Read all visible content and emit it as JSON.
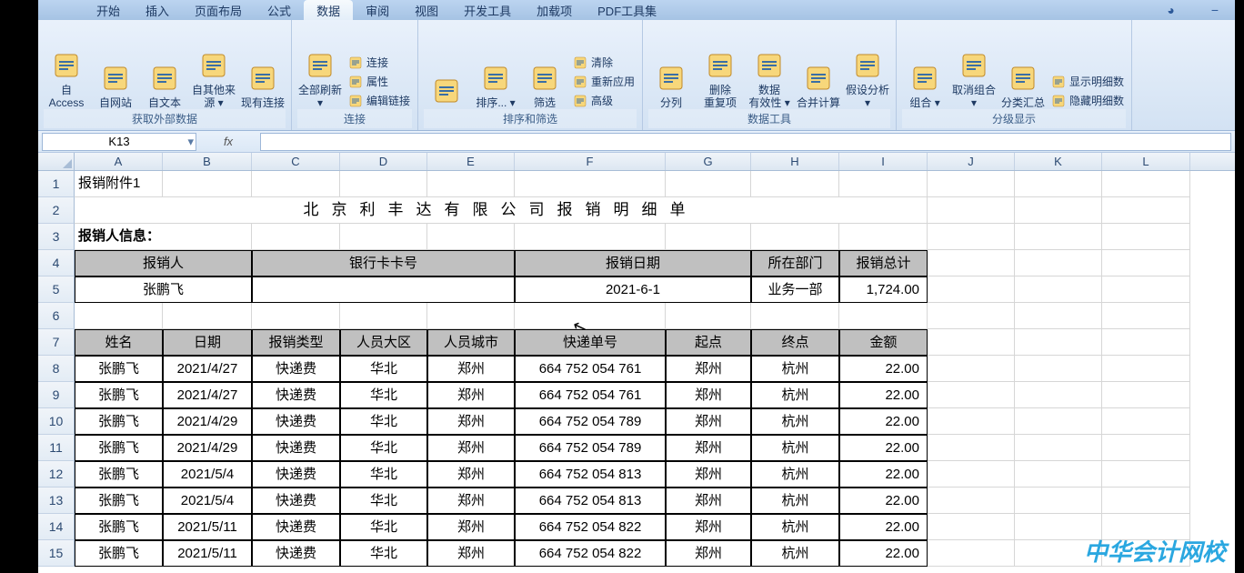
{
  "tabs": {
    "items": [
      "开始",
      "插入",
      "页面布局",
      "公式",
      "数据",
      "审阅",
      "视图",
      "开发工具",
      "加载项",
      "PDF工具集"
    ],
    "activeIndex": 4
  },
  "ribbon": {
    "groups": [
      {
        "label": "获取外部数据",
        "big": [
          {
            "name": "from-access",
            "label": "自 Access"
          },
          {
            "name": "from-web",
            "label": "自网站"
          },
          {
            "name": "from-text",
            "label": "自文本"
          },
          {
            "name": "from-other",
            "label": "自其他来源",
            "dd": true
          },
          {
            "name": "existing-conn",
            "label": "现有连接"
          }
        ]
      },
      {
        "label": "连接",
        "big": [
          {
            "name": "refresh-all",
            "label": "全部刷新",
            "dd": true
          }
        ],
        "small": [
          {
            "name": "connections",
            "label": "连接"
          },
          {
            "name": "properties",
            "label": "属性"
          },
          {
            "name": "edit-links",
            "label": "编辑链接"
          }
        ]
      },
      {
        "label": "排序和筛选",
        "big": [
          {
            "name": "sort-az",
            "label": ""
          },
          {
            "name": "sort",
            "label": "排序...",
            "dd": true
          },
          {
            "name": "filter",
            "label": "筛选"
          }
        ],
        "small": [
          {
            "name": "clear",
            "label": "清除"
          },
          {
            "name": "reapply",
            "label": "重新应用"
          },
          {
            "name": "advanced",
            "label": "高级"
          }
        ]
      },
      {
        "label": "数据工具",
        "big": [
          {
            "name": "text-to-col",
            "label": "分列"
          },
          {
            "name": "remove-dup",
            "label": "删除\n重复项"
          },
          {
            "name": "data-valid",
            "label": "数据\n有效性",
            "dd": true
          },
          {
            "name": "consolidate",
            "label": "合并计算"
          },
          {
            "name": "whatif",
            "label": "假设分析",
            "dd": true
          }
        ]
      },
      {
        "label": "分级显示",
        "big": [
          {
            "name": "group",
            "label": "组合",
            "dd": true
          },
          {
            "name": "ungroup",
            "label": "取消组合",
            "dd": true
          },
          {
            "name": "subtotal",
            "label": "分类汇总"
          }
        ],
        "small": [
          {
            "name": "show-detail",
            "label": "显示明细数"
          },
          {
            "name": "hide-detail",
            "label": "隐藏明细数"
          }
        ]
      }
    ]
  },
  "namebox": "K13",
  "columns": [
    "A",
    "B",
    "C",
    "D",
    "E",
    "F",
    "G",
    "H",
    "I",
    "J",
    "K",
    "L"
  ],
  "sheet": {
    "attachTitle": "报销附件1",
    "bigTitle": "北京利丰达有限公司报销明细单",
    "infoLabel": "报销人信息：",
    "headerRow1": [
      "报销人",
      "银行卡卡号",
      "报销日期",
      "所在部门",
      "报销总计"
    ],
    "headerRow1Vals": [
      "张鹏飞",
      "",
      "2021-6-1",
      "业务一部",
      "1,724.00"
    ],
    "tblHdr": [
      "姓名",
      "日期",
      "报销类型",
      "人员大区",
      "人员城市",
      "快递单号",
      "起点",
      "终点",
      "金额"
    ],
    "rows": [
      {
        "r": 8,
        "d": [
          "张鹏飞",
          "2021/4/27",
          "快递费",
          "华北",
          "郑州",
          "664 752 054 761",
          "郑州",
          "杭州",
          "22.00"
        ]
      },
      {
        "r": 9,
        "d": [
          "张鹏飞",
          "2021/4/27",
          "快递费",
          "华北",
          "郑州",
          "664 752 054 761",
          "郑州",
          "杭州",
          "22.00"
        ]
      },
      {
        "r": 10,
        "d": [
          "张鹏飞",
          "2021/4/29",
          "快递费",
          "华北",
          "郑州",
          "664 752 054 789",
          "郑州",
          "杭州",
          "22.00"
        ]
      },
      {
        "r": 11,
        "d": [
          "张鹏飞",
          "2021/4/29",
          "快递费",
          "华北",
          "郑州",
          "664 752 054 789",
          "郑州",
          "杭州",
          "22.00"
        ]
      },
      {
        "r": 12,
        "d": [
          "张鹏飞",
          "2021/5/4",
          "快递费",
          "华北",
          "郑州",
          "664 752 054 813",
          "郑州",
          "杭州",
          "22.00"
        ]
      },
      {
        "r": 13,
        "d": [
          "张鹏飞",
          "2021/5/4",
          "快递费",
          "华北",
          "郑州",
          "664 752 054 813",
          "郑州",
          "杭州",
          "22.00"
        ]
      },
      {
        "r": 14,
        "d": [
          "张鹏飞",
          "2021/5/11",
          "快递费",
          "华北",
          "郑州",
          "664 752 054 822",
          "郑州",
          "杭州",
          "22.00"
        ]
      },
      {
        "r": 15,
        "d": [
          "张鹏飞",
          "2021/5/11",
          "快递费",
          "华北",
          "郑州",
          "664 752 054 822",
          "郑州",
          "杭州",
          "22.00"
        ]
      }
    ]
  },
  "watermark": "中华会计网校",
  "help_glyph": "◕",
  "minimize_glyph": "−"
}
